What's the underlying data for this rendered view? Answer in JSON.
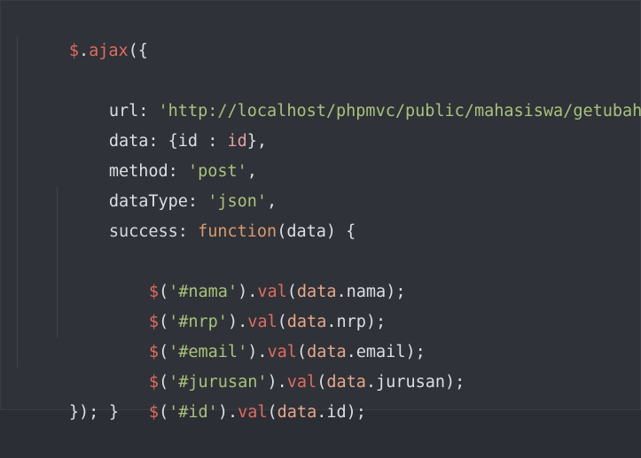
{
  "code": {
    "line1": {
      "dollar": "$",
      "dot": ".",
      "fn": "ajax",
      "open": "({"
    },
    "line2": {
      "key": "url: ",
      "value": "'http://localhost/phpmvc/public/mahasiswa/getubah'",
      "comma": ","
    },
    "line3": {
      "key": "data: ",
      "open": "{id : ",
      "value": "id",
      "close": "},"
    },
    "line4": {
      "key": "method: ",
      "value": "'post'",
      "comma": ","
    },
    "line5": {
      "key": "dataType: ",
      "value": "'json'",
      "comma": ","
    },
    "line6": {
      "key": "success: ",
      "kw": "function",
      "params": "(data) {"
    },
    "line7": {
      "dollar": "$",
      "open": "(",
      "sel": "'#nama'",
      "mid": ").",
      "fn": "val",
      "p": "(",
      "obj": "data",
      "prop": ".nama",
      "end": ");"
    },
    "line8": {
      "dollar": "$",
      "open": "(",
      "sel": "'#nrp'",
      "mid": ").",
      "fn": "val",
      "p": "(",
      "obj": "data",
      "prop": ".nrp",
      "end": ");"
    },
    "line9": {
      "dollar": "$",
      "open": "(",
      "sel": "'#email'",
      "mid": ").",
      "fn": "val",
      "p": "(",
      "obj": "data",
      "prop": ".email",
      "end": ");"
    },
    "line10": {
      "dollar": "$",
      "open": "(",
      "sel": "'#jurusan'",
      "mid": ").",
      "fn": "val",
      "p": "(",
      "obj": "data",
      "prop": ".jurusan",
      "end": ");"
    },
    "line11": {
      "dollar": "$",
      "open": "(",
      "sel": "'#id'",
      "mid": ").",
      "fn": "val",
      "p": "(",
      "obj": "data",
      "prop": ".id",
      "end": ");"
    },
    "line12": {
      "close": "}"
    },
    "line13": {
      "close": "});"
    }
  },
  "colors": {
    "background": "#2f3238",
    "dollar": "#e06c5d",
    "string": "#a8c27a",
    "keyword": "#d99a6c",
    "plain": "#dcdfe4"
  }
}
